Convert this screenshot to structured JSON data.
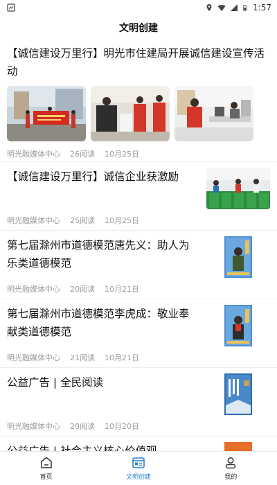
{
  "status_bar": {
    "time": "1:57"
  },
  "header": {
    "title": "文明创建"
  },
  "articles": [
    {
      "title": "【诚信建设万里行】明光市住建局开展诚信建设宣传活动",
      "source": "明光融媒体中心",
      "reads": "26阅读",
      "date": "10月25日"
    },
    {
      "title": "【诚信建设万里行】诚信企业获激励",
      "source": "明光融媒体中心",
      "reads": "25阅读",
      "date": "10月25日"
    },
    {
      "title": "第七届滁州市道德模范唐先义：助人为乐类道德模范",
      "source": "明光融媒体中心",
      "reads": "20阅读",
      "date": "10月21日"
    },
    {
      "title": "第七届滁州市道德模范李虎成：敬业奉献类道德模范",
      "source": "明光融媒体中心",
      "reads": "21阅读",
      "date": "10月21日"
    },
    {
      "title": "公益广告 | 全民阅读",
      "source": "明光融媒体中心",
      "reads": "20阅读",
      "date": "10月20日"
    },
    {
      "title": "公益广告 | 社会主义核心价值观"
    }
  ],
  "tabs": [
    {
      "label": "首页",
      "icon": "home-icon"
    },
    {
      "label": "文明创建",
      "icon": "news-icon"
    },
    {
      "label": "我的",
      "icon": "user-icon"
    }
  ],
  "colors": {
    "accent": "#2f7fd6",
    "meta_text": "#999999"
  }
}
